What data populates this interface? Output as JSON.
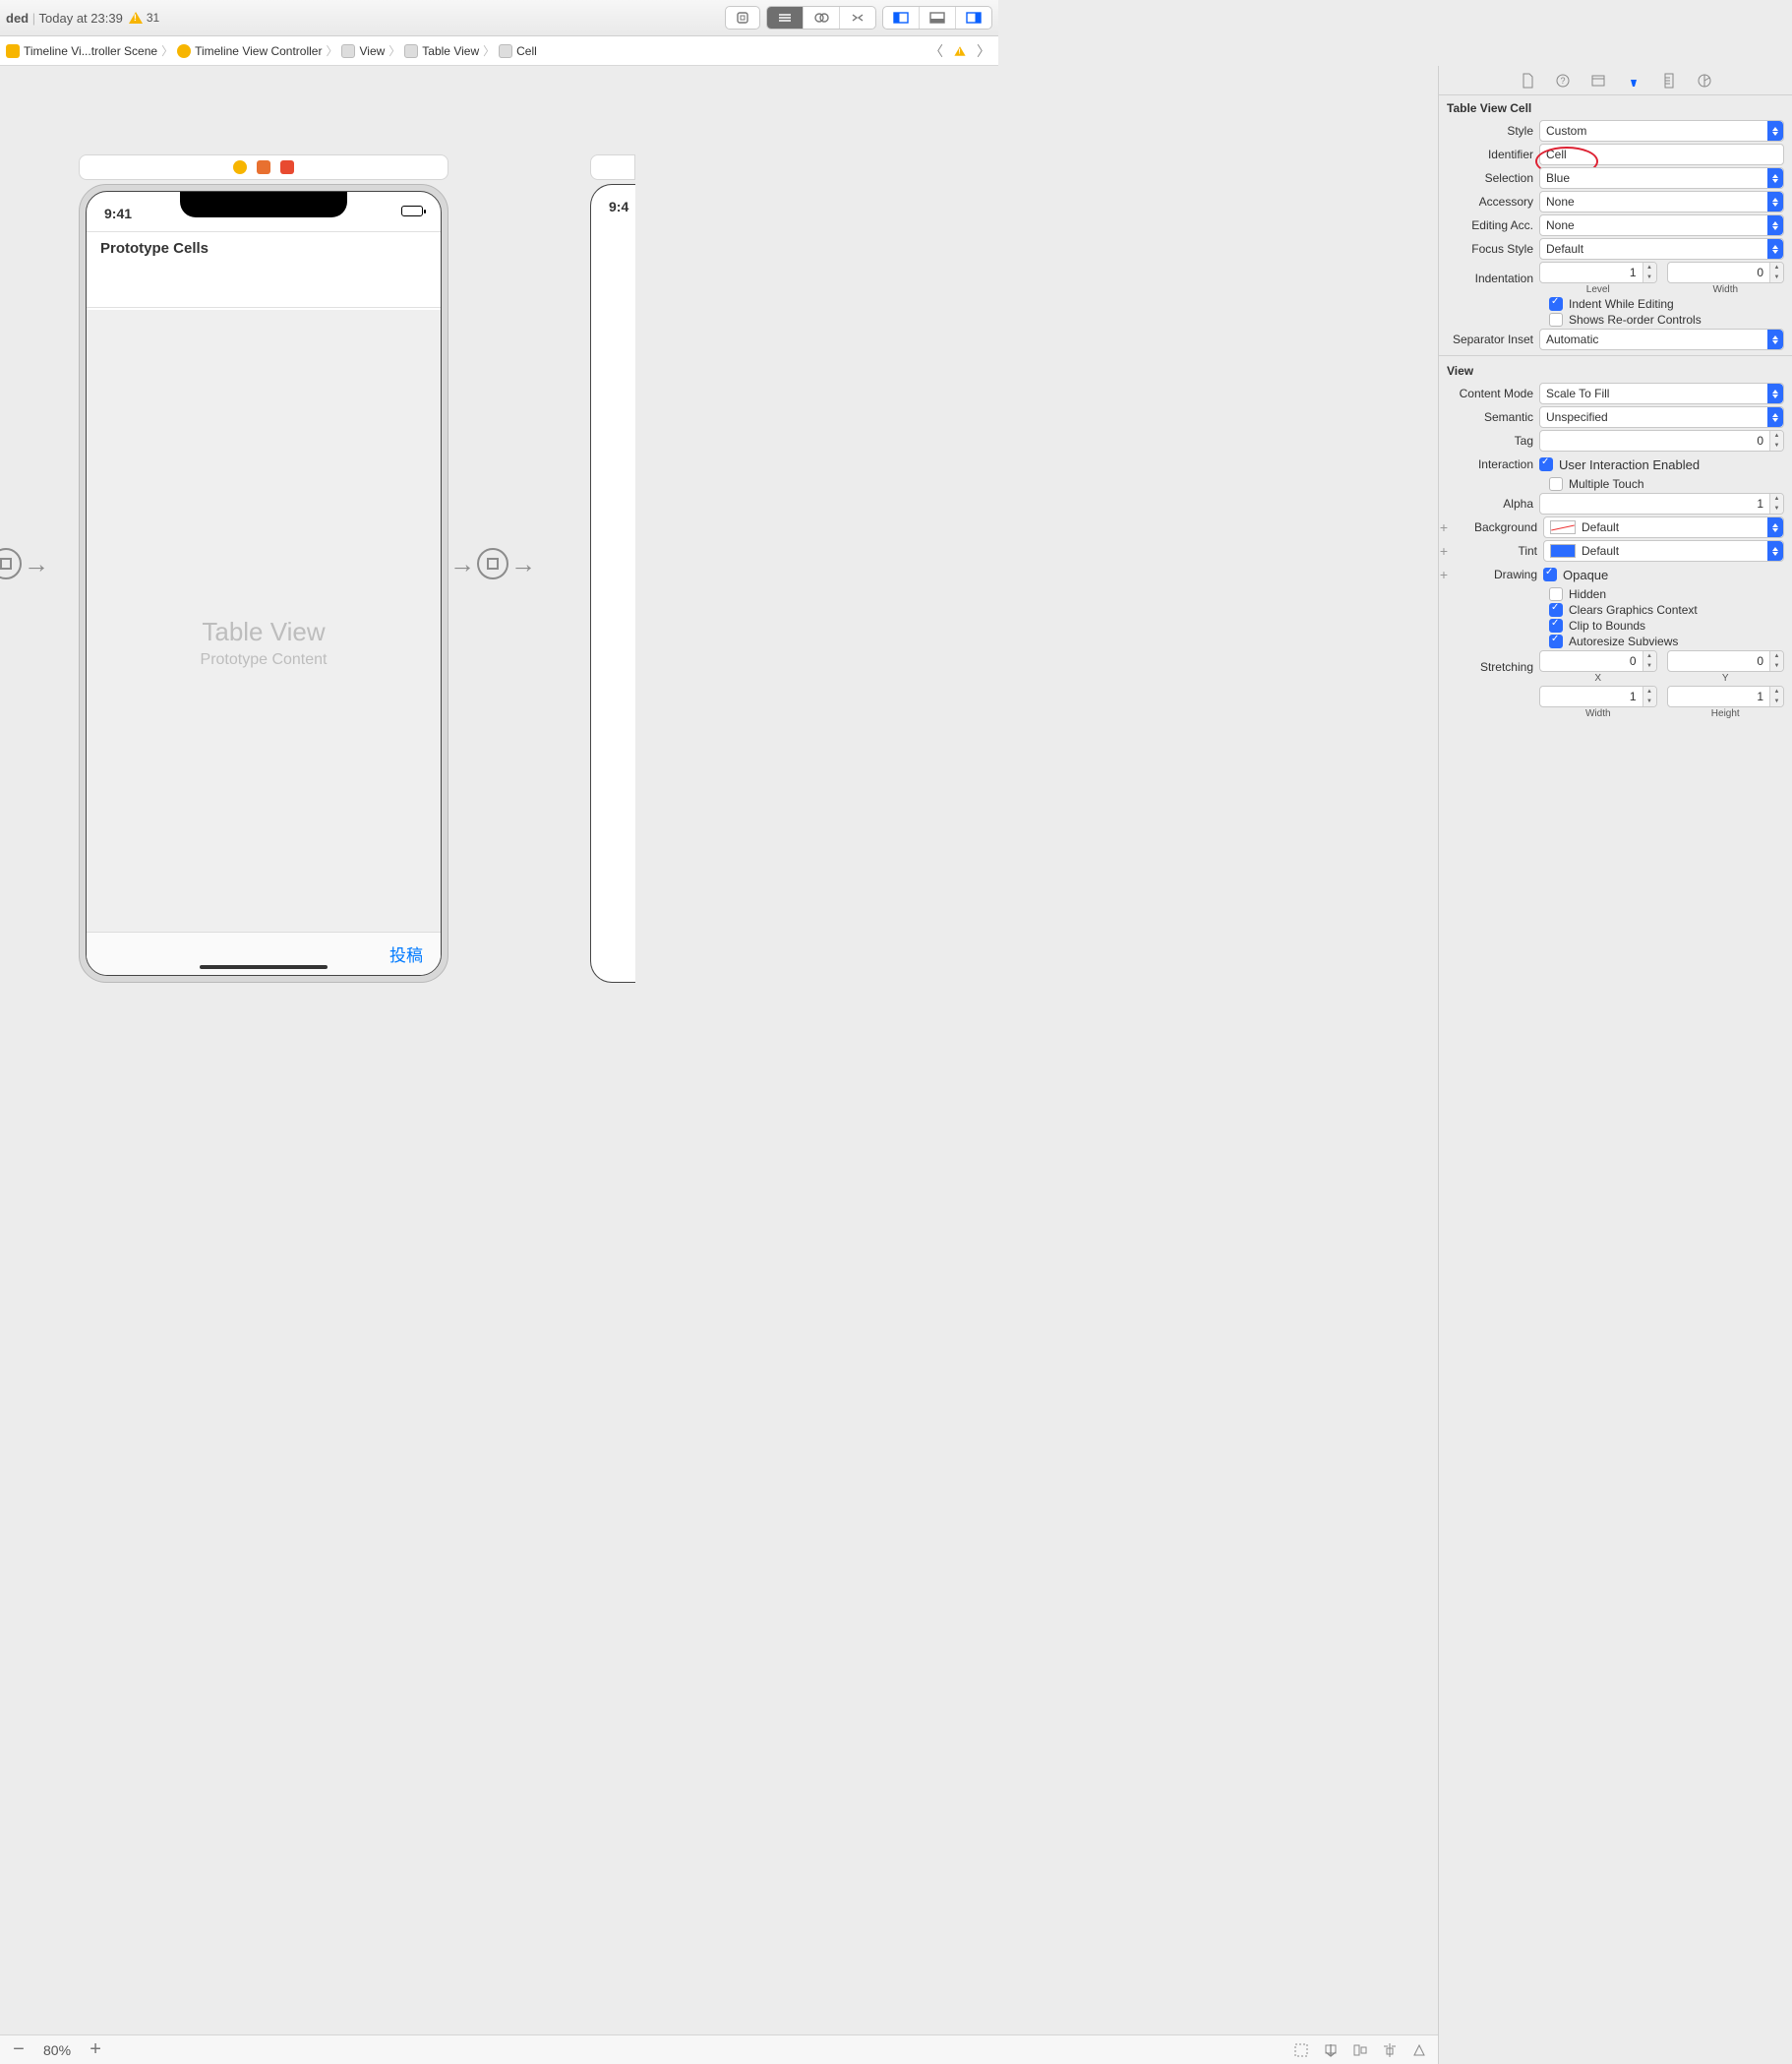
{
  "titlebar": {
    "status_prefix": "ded",
    "time": "Today at 23:39",
    "warn_count": "31"
  },
  "breadcrumbs": {
    "b1": "Timeline Vi...troller Scene",
    "b2": "Timeline View Controller",
    "b3": "View",
    "b4": "Table View",
    "b5": "Cell"
  },
  "canvas": {
    "status_time": "9:41",
    "proto_header": "Prototype Cells",
    "tv_title": "Table View",
    "tv_subtitle": "Prototype Content",
    "post_label": "投稿",
    "peek_time": "9:4",
    "zoom": "80%"
  },
  "inspector": {
    "section1": "Table View Cell",
    "style_lbl": "Style",
    "style_val": "Custom",
    "ident_lbl": "Identifier",
    "ident_val": "Cell",
    "sel_lbl": "Selection",
    "sel_val": "Blue",
    "acc_lbl": "Accessory",
    "acc_val": "None",
    "edacc_lbl": "Editing Acc.",
    "edacc_val": "None",
    "focus_lbl": "Focus Style",
    "focus_val": "Default",
    "indent_lbl": "Indentation",
    "indent_level": "1",
    "indent_width": "0",
    "indent_level_sub": "Level",
    "indent_width_sub": "Width",
    "indent_chk": "Indent While Editing",
    "reorder_chk": "Shows Re-order Controls",
    "sepinset_lbl": "Separator Inset",
    "sepinset_val": "Automatic",
    "section2": "View",
    "cmode_lbl": "Content Mode",
    "cmode_val": "Scale To Fill",
    "sem_lbl": "Semantic",
    "sem_val": "Unspecified",
    "tag_lbl": "Tag",
    "tag_val": "0",
    "inter_lbl": "Interaction",
    "inter_chk1": "User Interaction Enabled",
    "inter_chk2": "Multiple Touch",
    "alpha_lbl": "Alpha",
    "alpha_val": "1",
    "bg_lbl": "Background",
    "bg_val": "Default",
    "tint_lbl": "Tint",
    "tint_val": "Default",
    "draw_lbl": "Drawing",
    "draw1": "Opaque",
    "draw2": "Hidden",
    "draw3": "Clears Graphics Context",
    "draw4": "Clip to Bounds",
    "draw5": "Autoresize Subviews",
    "stretch_lbl": "Stretching",
    "stretch_x": "0",
    "stretch_y": "0",
    "stretch_w": "1",
    "stretch_h": "1",
    "sub_x": "X",
    "sub_y": "Y",
    "sub_w": "Width",
    "sub_h": "Height"
  }
}
